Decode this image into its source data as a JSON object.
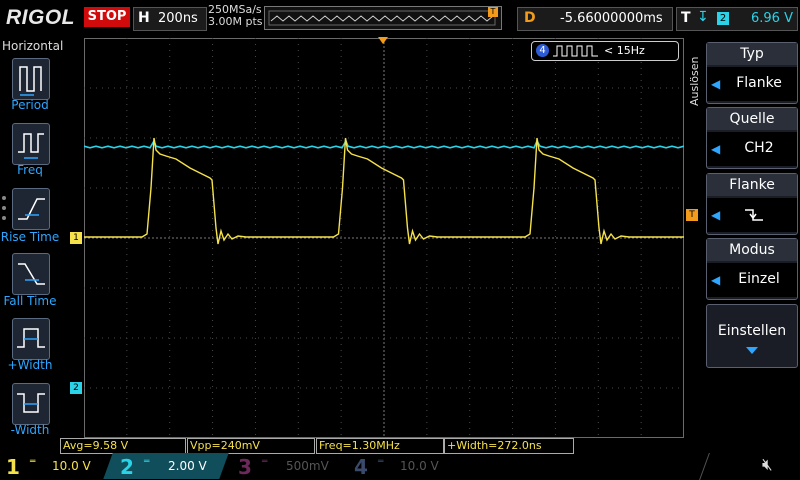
{
  "header": {
    "logo": "RIGOL",
    "run_state": "STOP",
    "timebase_label": "H",
    "timebase_value": "200ns",
    "sample_rate": "250MSa/s",
    "memory_depth": "3.00M pts",
    "mem_trigger_marker": "T",
    "delay_label": "D",
    "delay_value": "-5.66000000ms",
    "trigger_label": "T",
    "trigger_source_badge": "2",
    "trigger_level": "6.96 V"
  },
  "left_menu": {
    "title": "Horizontal",
    "items": [
      {
        "label": "Period",
        "icon": "period-icon"
      },
      {
        "label": "Freq",
        "icon": "freq-icon"
      },
      {
        "label": "Rise Time",
        "icon": "rise-time-icon"
      },
      {
        "label": "Fall Time",
        "icon": "fall-time-icon"
      },
      {
        "label": "+Width",
        "icon": "positive-width-icon"
      },
      {
        "label": "-Width",
        "icon": "negative-width-icon"
      }
    ]
  },
  "screen": {
    "ch4_badge": "4",
    "ch4_freq": "< 15Hz",
    "ch1_marker": "1",
    "ch2_marker": "2",
    "trigger_marker": "T"
  },
  "right_menu": {
    "tab_label": "Auslösen",
    "items": [
      {
        "header": "Typ",
        "value": "Flanke"
      },
      {
        "header": "Quelle",
        "value": "CH2"
      },
      {
        "header": "Flanke",
        "value": "falling-edge-icon"
      },
      {
        "header": "Modus",
        "value": "Einzel"
      }
    ],
    "settings_label": "Einstellen"
  },
  "measurements": [
    {
      "text": "Avg=9.58 V"
    },
    {
      "text": "Vpp=240mV"
    },
    {
      "text": "Freq=1.30MHz"
    },
    {
      "text": "+Width=272.0ns"
    }
  ],
  "channels": [
    {
      "num": "1",
      "scale": "10.0 V",
      "color": "#f5e14a",
      "active": true
    },
    {
      "num": "2",
      "scale": "2.00 V",
      "color": "#2ad3e8",
      "active": true
    },
    {
      "num": "3",
      "scale": "500mV",
      "color": "#a0207a",
      "active": false
    },
    {
      "num": "4",
      "scale": "10.0 V",
      "color": "#2d5bd8",
      "active": false
    }
  ],
  "colors": {
    "ch1": "#f5e14a",
    "ch2": "#2ad3e8",
    "trigger": "#f39c1b",
    "accent": "#2ea6ff"
  }
}
